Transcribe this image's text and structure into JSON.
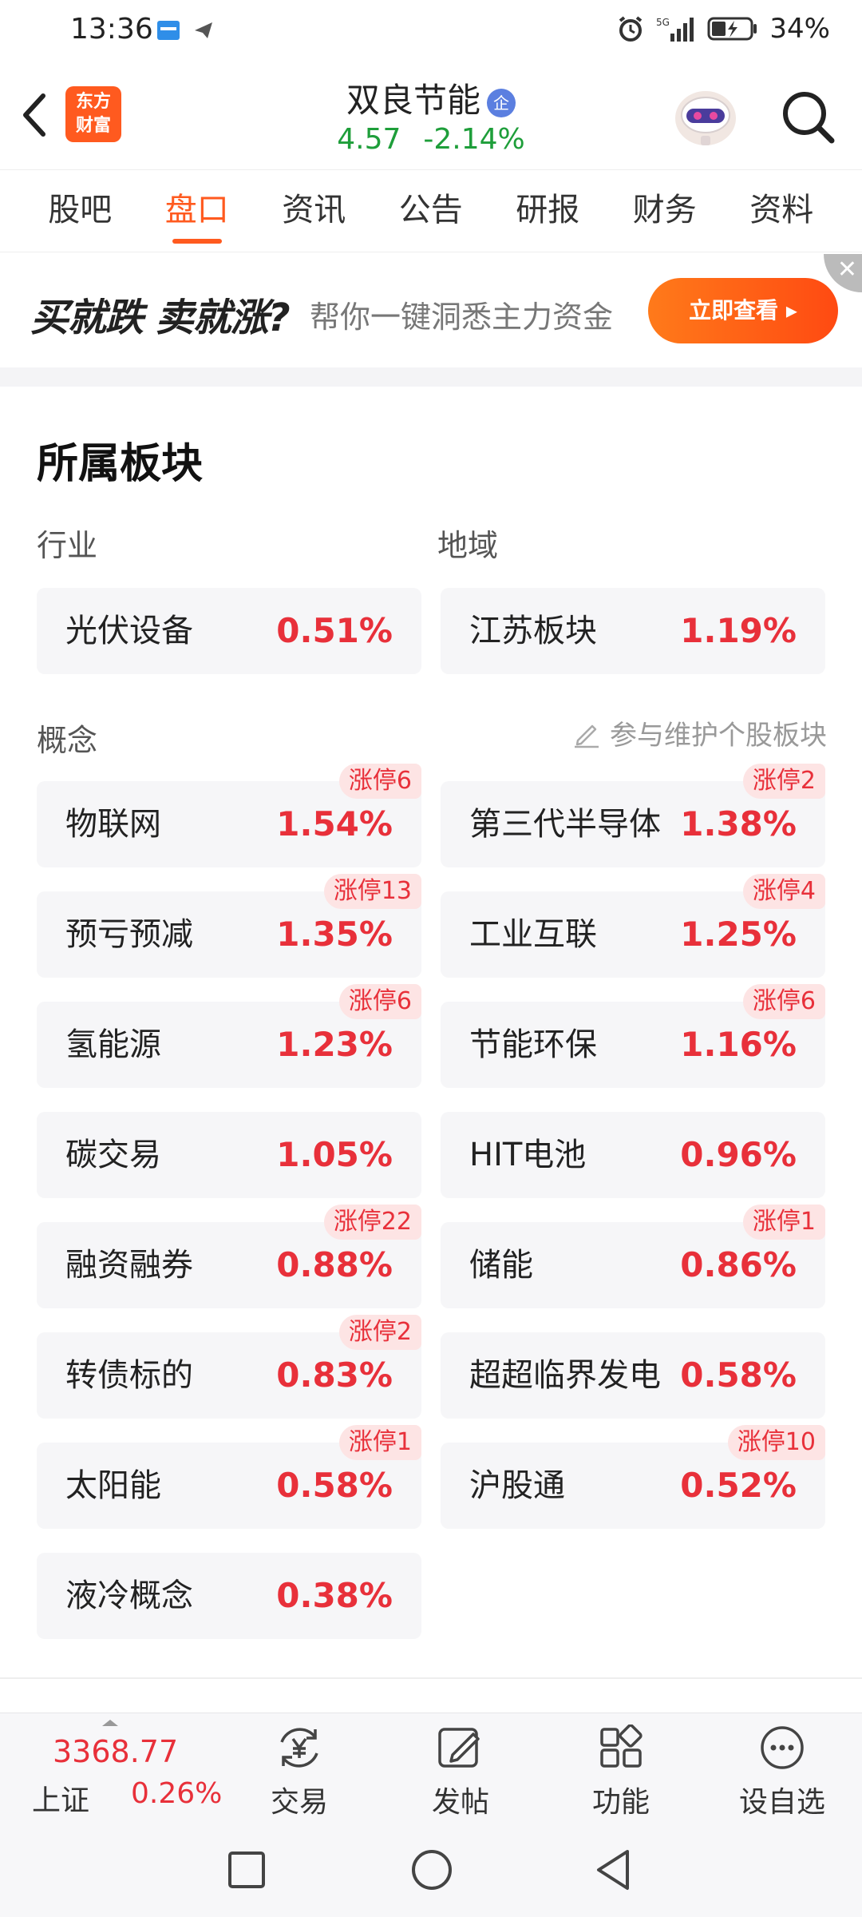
{
  "status_bar": {
    "time": "13:36",
    "battery": "34%",
    "icons": [
      "alarm-icon",
      "signal-5g-icon",
      "battery-icon"
    ]
  },
  "header": {
    "stock_name": "双良节能",
    "badge": "企",
    "price": "4.57",
    "change": "-2.14%",
    "logo_line1": "东方",
    "logo_line2": "财富",
    "colors": {
      "down": "#1e9e3a",
      "up": "#e8303a",
      "accent": "#ff5a1f"
    }
  },
  "tabs": [
    {
      "label": "股吧"
    },
    {
      "label": "盘口",
      "active": true
    },
    {
      "label": "资讯"
    },
    {
      "label": "公告"
    },
    {
      "label": "研报"
    },
    {
      "label": "财务"
    },
    {
      "label": "资料"
    }
  ],
  "banner": {
    "title": "买就跌 卖就涨?",
    "subtitle": "帮你一键洞悉主力资金",
    "button": "立即查看 ▸"
  },
  "section": {
    "title": "所属板块",
    "industry_label": "行业",
    "region_label": "地域",
    "concept_label": "概念",
    "maintain_link": "参与维护个股板块"
  },
  "industry": {
    "name": "光伏设备",
    "pct": "0.51%"
  },
  "region": {
    "name": "江苏板块",
    "pct": "1.19%"
  },
  "concepts": [
    {
      "name": "物联网",
      "pct": "1.54%",
      "tag": "涨停6"
    },
    {
      "name": "第三代半导体",
      "pct": "1.38%",
      "tag": "涨停2"
    },
    {
      "name": "预亏预减",
      "pct": "1.35%",
      "tag": "涨停13"
    },
    {
      "name": "工业互联",
      "pct": "1.25%",
      "tag": "涨停4"
    },
    {
      "name": "氢能源",
      "pct": "1.23%",
      "tag": "涨停6"
    },
    {
      "name": "节能环保",
      "pct": "1.16%",
      "tag": "涨停6"
    },
    {
      "name": "碳交易",
      "pct": "1.05%",
      "tag": ""
    },
    {
      "name": "HIT电池",
      "pct": "0.96%",
      "tag": ""
    },
    {
      "name": "融资融券",
      "pct": "0.88%",
      "tag": "涨停22"
    },
    {
      "name": "储能",
      "pct": "0.86%",
      "tag": "涨停1"
    },
    {
      "name": "转债标的",
      "pct": "0.83%",
      "tag": "涨停2"
    },
    {
      "name": "超超临界发电",
      "pct": "0.58%",
      "tag": ""
    },
    {
      "name": "太阳能",
      "pct": "0.58%",
      "tag": "涨停1"
    },
    {
      "name": "沪股通",
      "pct": "0.52%",
      "tag": "涨停10"
    },
    {
      "name": "液冷概念",
      "pct": "0.38%",
      "tag": ""
    }
  ],
  "bottom_bar": {
    "index_value": "3368.77",
    "index_name": "上证",
    "index_pct": "0.26%",
    "items": [
      {
        "label": "交易",
        "icon": "yuan-exchange-icon"
      },
      {
        "label": "发帖",
        "icon": "edit-icon"
      },
      {
        "label": "功能",
        "icon": "grid-icon"
      },
      {
        "label": "设自选",
        "icon": "more-icon"
      }
    ]
  }
}
